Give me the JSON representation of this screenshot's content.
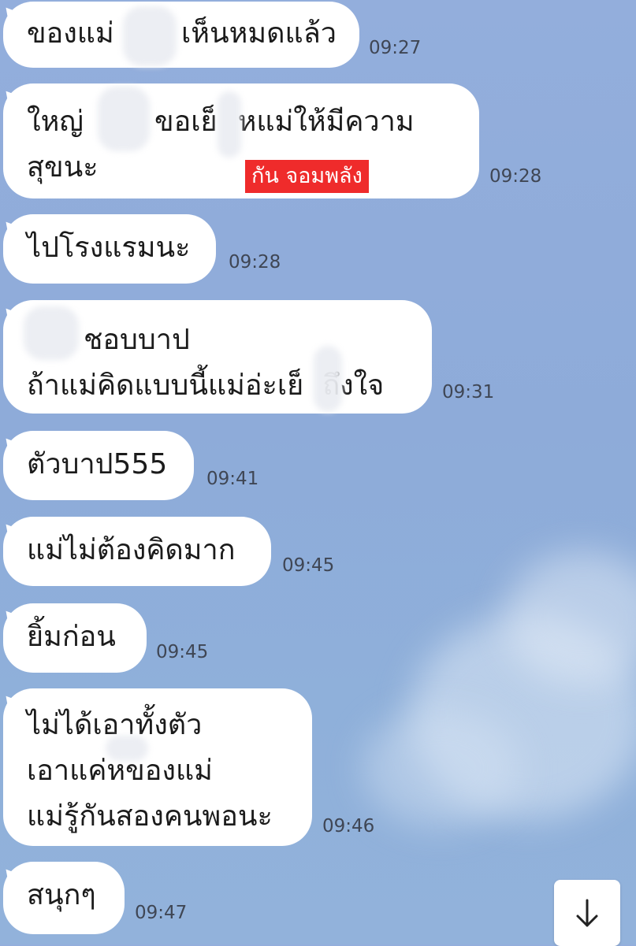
{
  "messages": [
    {
      "lines": [
        "ของแม่",
        "เห็นหมดแล้ว"
      ],
      "time": "09:27"
    },
    {
      "lines": [
        "ใหญ่",
        "ขอเย็",
        "หแม่ให้มีความ",
        "สุขนะ"
      ],
      "time": "09:28",
      "label": "กัน จอมพลัง"
    },
    {
      "lines": [
        "ไปโรงแรมนะ"
      ],
      "time": "09:28"
    },
    {
      "lines": [
        "ชอบบาป",
        "ถ้าแม่คิดแบบนี้แม่อ่ะเย็",
        "ถึงใจ"
      ],
      "time": "09:31"
    },
    {
      "lines": [
        "ตัวบาป555"
      ],
      "time": "09:41"
    },
    {
      "lines": [
        "แม่ไม่ต้องคิดมาก"
      ],
      "time": "09:45"
    },
    {
      "lines": [
        "ยิ้มก่อน"
      ],
      "time": "09:45"
    },
    {
      "lines": [
        "ไม่ได้เอาทั้งตัว",
        "เอาแค่หของแม่",
        "แม่รู้กันสองคนพอนะ"
      ],
      "time": "09:46"
    },
    {
      "lines": [
        "สนุกๆ"
      ],
      "time": "09:47"
    }
  ],
  "scroll_button": {
    "icon": "arrow-down-icon",
    "glyph": "↓"
  }
}
